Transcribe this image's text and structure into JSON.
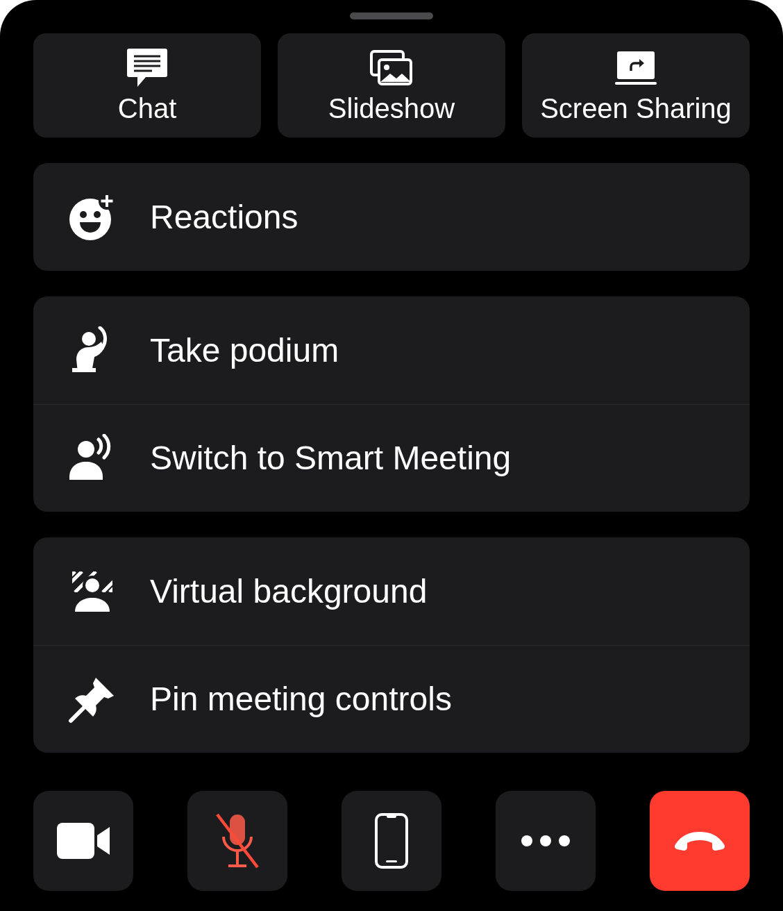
{
  "top_actions": [
    {
      "kind": "chat",
      "label": "Chat"
    },
    {
      "kind": "slideshow",
      "label": "Slideshow"
    },
    {
      "kind": "screen_share",
      "label": "Screen Sharing"
    }
  ],
  "menu_groups": [
    [
      {
        "kind": "reactions",
        "label": "Reactions"
      }
    ],
    [
      {
        "kind": "podium",
        "label": "Take podium"
      },
      {
        "kind": "smart_meeting",
        "label": "Switch to Smart Meeting"
      }
    ],
    [
      {
        "kind": "virtual_background",
        "label": "Virtual background"
      },
      {
        "kind": "pin",
        "label": "Pin meeting controls"
      }
    ]
  ],
  "bottom_controls": [
    {
      "kind": "camera"
    },
    {
      "kind": "microphone",
      "muted": true
    },
    {
      "kind": "device"
    },
    {
      "kind": "more"
    },
    {
      "kind": "end_call"
    }
  ]
}
